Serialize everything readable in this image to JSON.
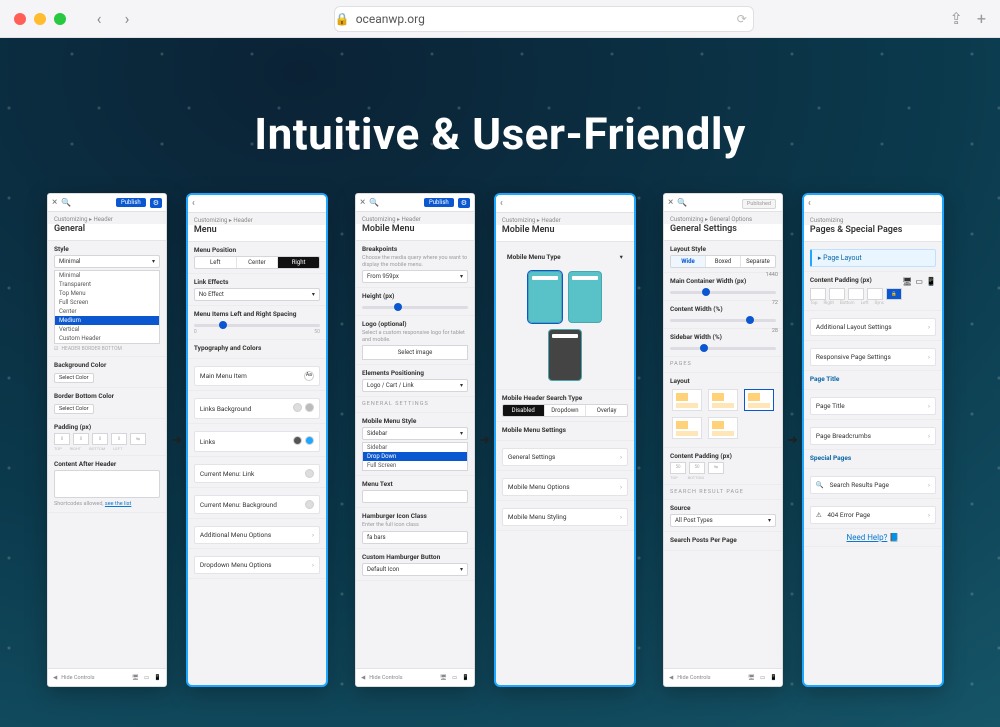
{
  "browser": {
    "url_host": "oceanwp.org",
    "back": "‹",
    "fwd": "›",
    "share": "⇪",
    "plus": "+"
  },
  "title": "Intuitive & User-Friendly",
  "panel1L": {
    "publish": "Publish",
    "crumb": "Customizing ▸ Header",
    "heading": "General",
    "style_label": "Style",
    "style_value": "Minimal",
    "style_options": [
      "Minimal",
      "Transparent",
      "Top Menu",
      "Full Screen",
      "Center",
      "Medium",
      "Vertical",
      "Custom Header"
    ],
    "style_selected_index": 5,
    "header_border_bottom": "HEADER BORDER BOTTOM",
    "bg_label": "Background Color",
    "select_color": "Select Color",
    "border_bottom_label": "Border Bottom Color",
    "padding_label": "Padding (px)",
    "padding_vals": [
      "0",
      "0",
      "0",
      "0"
    ],
    "padding_sides": [
      "TOP",
      "RIGHT",
      "BOTTOM",
      "LEFT"
    ],
    "content_after_label": "Content After Header",
    "shortcodes_note": "Shortcodes allowed,",
    "shortcodes_link": "see the list",
    "hide_controls": "Hide Controls"
  },
  "panel1R": {
    "crumb": "Customizing ▸ Header",
    "heading": "Menu",
    "menu_position": "Menu Position",
    "positions": [
      "Left",
      "Center",
      "Right"
    ],
    "link_effects": "Link Effects",
    "link_effects_value": "No Effect",
    "spacing_label": "Menu Items Left and Right Spacing",
    "spacing_min": "0",
    "spacing_max": "50",
    "typo_section": "Typography and Colors",
    "main_menu_item": "Main Menu Item",
    "links_bg": "Links Background",
    "links": "Links",
    "cur_link": "Current Menu: Link",
    "cur_bg": "Current Menu: Background",
    "addl": "Additional Menu Options",
    "dropdown": "Dropdown Menu Options"
  },
  "panel2L": {
    "publish": "Publish",
    "crumb": "Customizing ▸ Header",
    "heading": "Mobile Menu",
    "breakpoints": "Breakpoints",
    "breakpoints_help": "Choose the media query where you want to display the mobile menu.",
    "breakpoints_value": "From 959px",
    "height_label": "Height (px)",
    "logo_label": "Logo (optional)",
    "logo_help": "Select a custom responsive logo for tablet and mobile.",
    "select_image": "Select image",
    "elements_pos": "Elements Positioning",
    "elements_value": "Logo / Cart / Link",
    "general_settings": "GENERAL  SETTINGS",
    "mobile_menu_style": "Mobile Menu Style",
    "mm_options": [
      "Sidebar",
      "Drop Down",
      "Full Screen"
    ],
    "mm_selected_index": 1,
    "menu_text": "Menu Text",
    "hamburger_label": "Hamburger Icon Class",
    "hamburger_help": "Enter the full icon class",
    "hamburger_value": "fa bars",
    "custom_hb": "Custom Hamburger Button",
    "custom_hb_value": "Default Icon",
    "hide_controls": "Hide Controls"
  },
  "panel2R": {
    "crumb": "Customizing ▸ Header",
    "heading": "Mobile Menu",
    "type_label": "Mobile Menu Type",
    "search_type": "Mobile Header Search Type",
    "search_opts": [
      "Disabled",
      "Dropdown",
      "Overlay"
    ],
    "mm_settings": "Mobile Menu Settings",
    "rows": [
      "General Settings",
      "Mobile Menu Options",
      "Mobile Menu Styling"
    ]
  },
  "panel3L": {
    "published": "Published",
    "crumb": "Customizing ▸ General Options",
    "heading": "General Settings",
    "layout_style": "Layout Style",
    "layout_opts": [
      "Wide",
      "Boxed",
      "Separate"
    ],
    "main_w": "Main Container Width (px)",
    "main_w_val": "1440",
    "content_w": "Content Width (%)",
    "content_w_val": "72",
    "sidebar_w": "Sidebar Width (%)",
    "sidebar_w_val": "28",
    "pages_section": "PAGES",
    "layout_label": "Layout",
    "content_padding": "Content Padding (px)",
    "cp_vals": [
      "50",
      "50"
    ],
    "cp_sides": [
      "TOP",
      "BOTTOM"
    ],
    "srp": "SEARCH  RESULT  PAGE",
    "source": "Source",
    "source_value": "All Post Types",
    "spp": "Search Posts Per Page",
    "hide_controls": "Hide Controls"
  },
  "panel3R": {
    "crumb": "Customizing",
    "heading": "Pages & Special Pages",
    "page_layout": "Page Layout",
    "cp_label": "Content Padding (px)",
    "cp_sides": [
      "Top",
      "Right",
      "Bottom",
      "Left",
      "Sync"
    ],
    "rows1": [
      "Additional Layout Settings",
      "Responsive Page Settings"
    ],
    "page_title_sec": "Page Title",
    "rows2": [
      "Page Title",
      "Page Breadcrumbs"
    ],
    "special_sec": "Special Pages",
    "rows3": [
      "Search Results Page",
      "404 Error Page"
    ],
    "need_help": "Need Help?"
  }
}
